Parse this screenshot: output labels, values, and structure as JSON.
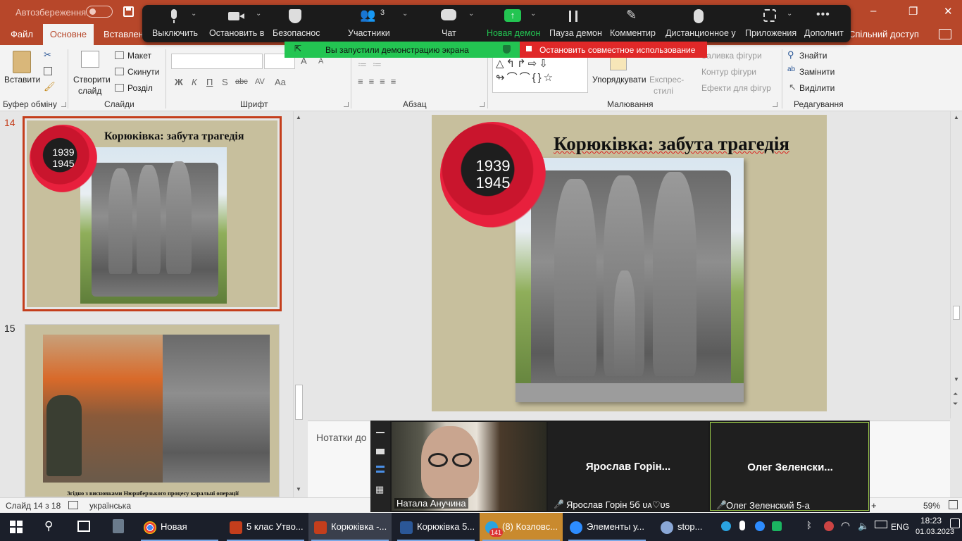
{
  "titlebar": {
    "autosave_label": "Автозбереження",
    "window_controls": [
      "–",
      "❐",
      "✕"
    ]
  },
  "ribbon_tabs": {
    "file": "Файл",
    "home": "Основне",
    "insert": "Вставлення",
    "share": "Спільний доступ"
  },
  "ribbon": {
    "clipboard": {
      "paste": "Вставити",
      "label": "Буфер обміну"
    },
    "slides": {
      "new_slide_1": "Створити",
      "new_slide_2": "слайд",
      "layout": "Макет",
      "reset": "Скинути",
      "section": "Розділ",
      "label": "Слайди"
    },
    "font": {
      "bold": "Ж",
      "italic": "К",
      "underline": "П",
      "shadow": "S",
      "strike": "abc",
      "spacing": "AV",
      "case": "Aa",
      "label": "Шрифт"
    },
    "paragraph": {
      "label": "Абзац"
    },
    "drawing": {
      "arrange": "Упорядкувати",
      "quick_styles_1": "Експрес-",
      "quick_styles_2": "стилі",
      "shape_fill": "Заливка фігури",
      "shape_outline": "Контур фігури",
      "shape_effects": "Ефекти для фігур",
      "label": "Малювання"
    },
    "editing": {
      "find": "Знайти",
      "replace": "Замінити",
      "select": "Виділити",
      "label": "Редагування"
    }
  },
  "zoom_toolbar": {
    "mute": "Выключить",
    "stop_video": "Остановить в",
    "security": "Безопаснос",
    "participants": "Участники",
    "participants_count": "3",
    "chat": "Чат",
    "new_share": "Новая демон",
    "pause_share": "Пауза демон",
    "annotate": "Комментир",
    "remote_control": "Дистанционное у",
    "apps": "Приложения",
    "more": "Дополнит",
    "sharing_banner": "Вы запустили демонстрацию экрана",
    "stop_share": "Остановить совместное использование",
    "accent": "#23c552",
    "stop_color": "#e02828"
  },
  "thumbnails": [
    {
      "number": "14",
      "title": "Корюківка: забута трагедія",
      "years": [
        "1939",
        "1945"
      ]
    },
    {
      "number": "15",
      "caption": "Згідно з висновками Нюрнберзького процесу каральні операції"
    }
  ],
  "main_slide": {
    "title": "Корюківка: забута трагедія",
    "years": [
      "1939",
      "1945"
    ]
  },
  "notes_placeholder": "Нотатки до",
  "statusbar": {
    "slide_info": "Слайд 14 з 18",
    "language": "українська",
    "zoom": "59%"
  },
  "gallery": {
    "participants": [
      {
        "name": "Натала Анучина",
        "muted": false
      },
      {
        "display": "Ярослав  Горін...",
        "name": "Ярослав Горін 5б ᴜᴀ♡ᴜs",
        "muted": true
      },
      {
        "display": "Олег  Зеленски...",
        "name": "Олег Зеленский 5-а",
        "muted": true
      }
    ]
  },
  "taskbar": {
    "apps": [
      {
        "label": "Новая вклад...",
        "icon": "chrome-icon"
      },
      {
        "label": "5 клас Утво...",
        "icon": "powerpoint-icon"
      },
      {
        "label": "Корюківка -...",
        "icon": "powerpoint-icon"
      },
      {
        "label": "Корюківка 5...",
        "icon": "word-icon"
      },
      {
        "label": "(8) Козловс...",
        "icon": "telegram-icon",
        "badge": "141"
      },
      {
        "label": "Элементы у...",
        "icon": "zoom-icon"
      },
      {
        "label": "stop...",
        "icon": "people-icon"
      }
    ],
    "language": "ENG",
    "time": "18:23",
    "date": "01.03.2023"
  }
}
